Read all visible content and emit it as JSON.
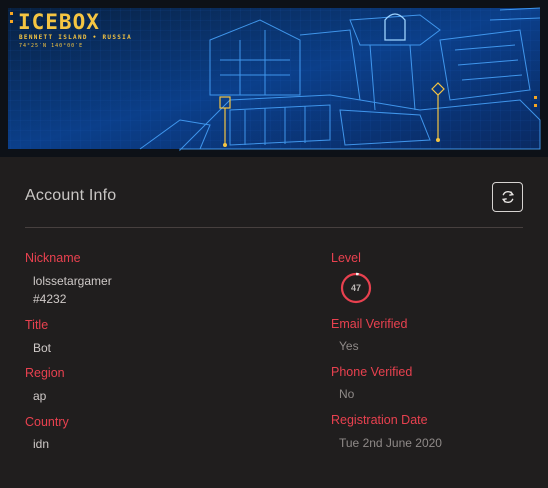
{
  "banner": {
    "map_name": "ICEBOX",
    "location": "BENNETT ISLAND • RUSSIA",
    "coordinates": "74°25′N 140°00′E"
  },
  "account": {
    "title": "Account Info",
    "refresh_icon": "refresh-icon",
    "fields": {
      "nickname": {
        "label": "Nickname",
        "name": "lolssetargamer",
        "tag": "#4232"
      },
      "title": {
        "label": "Title",
        "value": "Bot"
      },
      "region": {
        "label": "Region",
        "value": "ap"
      },
      "country": {
        "label": "Country",
        "value": "idn"
      },
      "level": {
        "label": "Level",
        "value": "47",
        "progress_fraction": 0.03
      },
      "email_verified": {
        "label": "Email Verified",
        "value": "Yes"
      },
      "phone_verified": {
        "label": "Phone Verified",
        "value": "No"
      },
      "registration_date": {
        "label": "Registration Date",
        "value": "Tue 2nd June 2020"
      }
    }
  },
  "colors": {
    "accent": "#e8414f",
    "background": "#201e1e",
    "banner_title": "#f5c542",
    "blueprint": "#2f8cff"
  }
}
